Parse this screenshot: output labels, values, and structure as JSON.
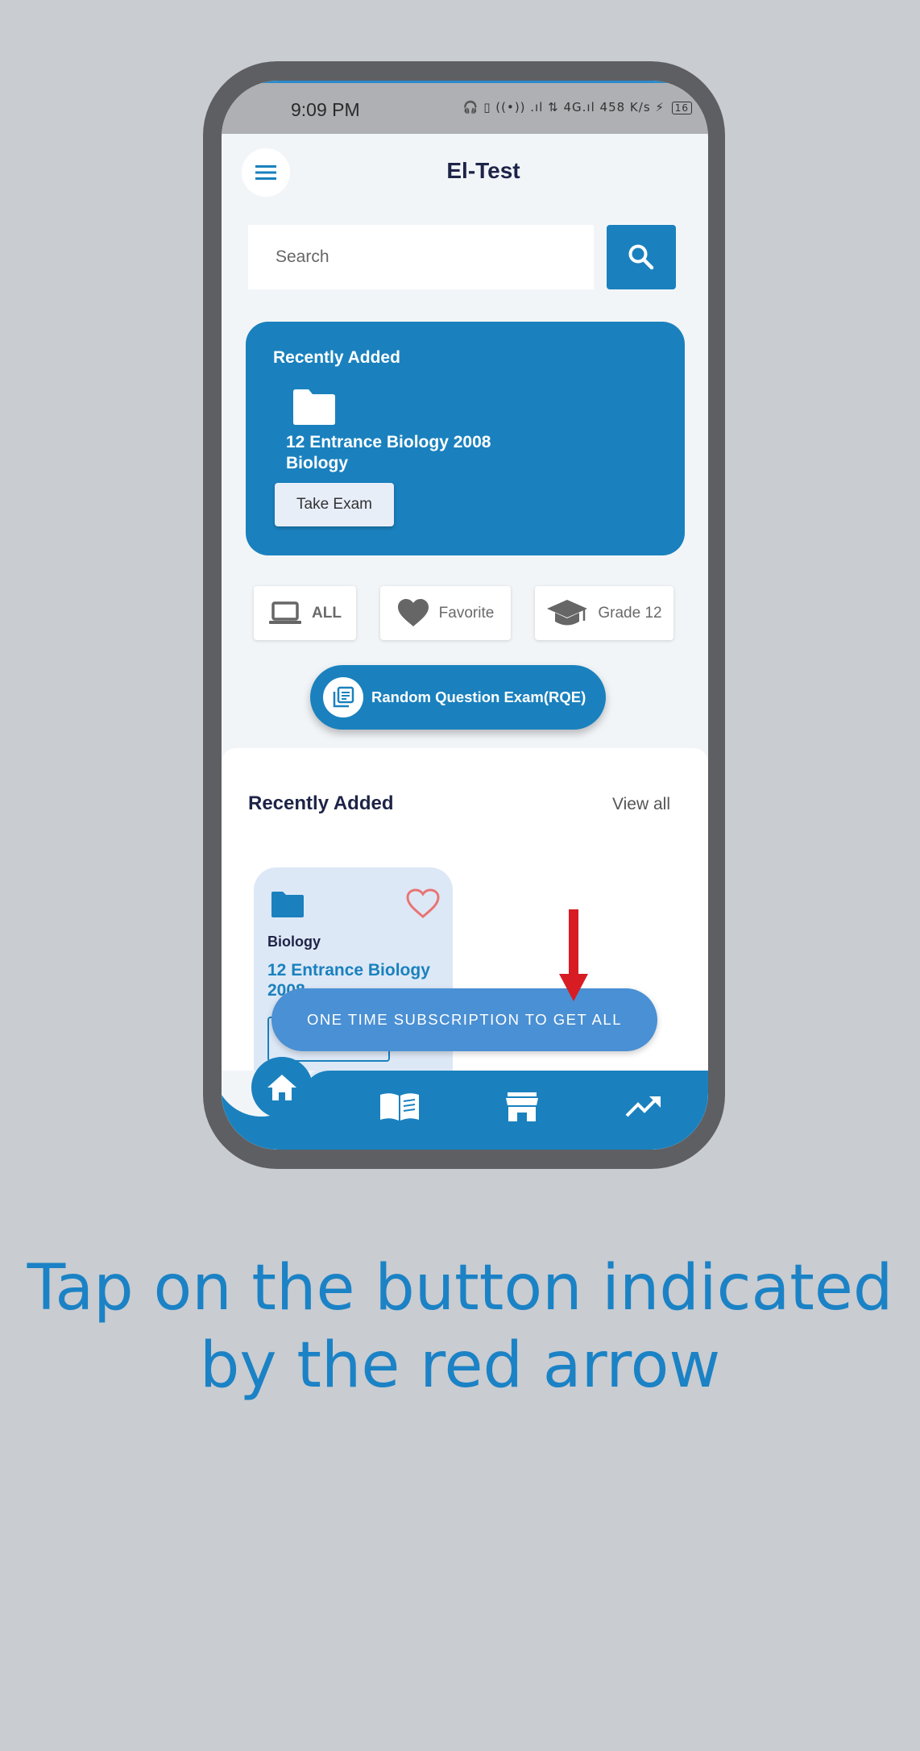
{
  "status_bar": {
    "time": "9:09 PM",
    "icons": "🎧 ▯ ((•)) .ıl ⇅ 4G.ıl 458 K/s ⚡",
    "battery": "16"
  },
  "app_bar": {
    "title": "El-Test"
  },
  "search": {
    "placeholder": "Search"
  },
  "recent_card": {
    "title": "Recently Added",
    "exam_line1": "12 Entrance Biology 2008",
    "exam_line2": "Biology",
    "button_label": "Take Exam"
  },
  "filters": [
    {
      "label": "ALL",
      "icon": "laptop-icon"
    },
    {
      "label": "Favorite",
      "icon": "heart-icon"
    },
    {
      "label": "Grade 12",
      "icon": "graduation-cap-icon"
    }
  ],
  "rqe_button": {
    "label": "Random Question Exam(RQE)"
  },
  "recently_added": {
    "title": "Recently Added",
    "view_all": "View all",
    "card": {
      "subject": "Biology",
      "title": "12 Entrance Biology 2008"
    }
  },
  "subscribe_button": {
    "label": "ONE TIME SUBSCRIPTION TO GET ALL"
  },
  "bottom_nav": [
    "home-icon",
    "book-icon",
    "store-icon",
    "trending-up-icon"
  ],
  "instruction": {
    "line1": "Tap on the button indicated",
    "line2": "by the red arrow"
  },
  "colors": {
    "primary": "#1a81be",
    "subscribe": "#4a90d4",
    "arrow": "#d71c24",
    "background": "#c9ccd1",
    "heading": "#1e2447"
  }
}
